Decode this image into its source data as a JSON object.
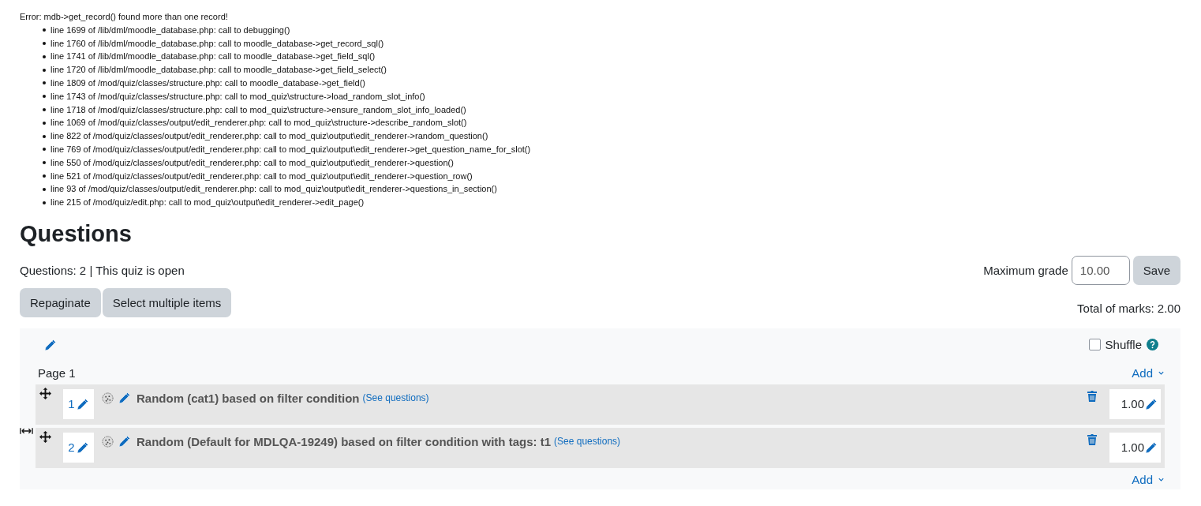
{
  "error": {
    "message": "Error: mdb->get_record() found more than one record!",
    "trace": [
      "line 1699 of /lib/dml/moodle_database.php: call to debugging()",
      "line 1760 of /lib/dml/moodle_database.php: call to moodle_database->get_record_sql()",
      "line 1741 of /lib/dml/moodle_database.php: call to moodle_database->get_field_sql()",
      "line 1720 of /lib/dml/moodle_database.php: call to moodle_database->get_field_select()",
      "line 1809 of /mod/quiz/classes/structure.php: call to moodle_database->get_field()",
      "line 1743 of /mod/quiz/classes/structure.php: call to mod_quiz\\structure->load_random_slot_info()",
      "line 1718 of /mod/quiz/classes/structure.php: call to mod_quiz\\structure->ensure_random_slot_info_loaded()",
      "line 1069 of /mod/quiz/classes/output/edit_renderer.php: call to mod_quiz\\structure->describe_random_slot()",
      "line 822 of /mod/quiz/classes/output/edit_renderer.php: call to mod_quiz\\output\\edit_renderer->random_question()",
      "line 769 of /mod/quiz/classes/output/edit_renderer.php: call to mod_quiz\\output\\edit_renderer->get_question_name_for_slot()",
      "line 550 of /mod/quiz/classes/output/edit_renderer.php: call to mod_quiz\\output\\edit_renderer->question()",
      "line 521 of /mod/quiz/classes/output/edit_renderer.php: call to mod_quiz\\output\\edit_renderer->question_row()",
      "line 93 of /mod/quiz/classes/output/edit_renderer.php: call to mod_quiz\\output\\edit_renderer->questions_in_section()",
      "line 215 of /mod/quiz/edit.php: call to mod_quiz\\output\\edit_renderer->edit_page()"
    ]
  },
  "heading": "Questions",
  "summary": "Questions: 2 | This quiz is open",
  "max_grade": {
    "label": "Maximum grade",
    "value": "10.00",
    "button": "Save"
  },
  "buttons": [
    "Repaginate",
    "Select multiple items"
  ],
  "total_marks": "Total of marks: 2.00",
  "section": {
    "shuffle": {
      "label": "Shuffle",
      "checked": false
    },
    "page": {
      "label": "Page 1",
      "add": "Add"
    },
    "questions": [
      {
        "number": "1",
        "title": "Random (cat1) based on filter condition",
        "link": "(See questions)",
        "mark": "1.00"
      },
      {
        "number": "2",
        "title": "Random (Default for MDLQA-19249) based on filter condition with tags: t1",
        "link": "(See questions)",
        "mark": "1.00"
      }
    ],
    "add": "Add"
  }
}
